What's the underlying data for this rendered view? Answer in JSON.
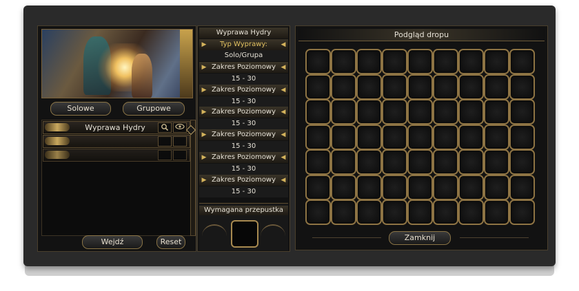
{
  "left": {
    "solo_label": "Solowe",
    "group_label": "Grupowe",
    "expeditions": [
      "Wyprawa Hydry",
      "",
      ""
    ],
    "enter_label": "Wejdź",
    "reset_label": "Reset"
  },
  "middle": {
    "title": "Wyprawa Hydry",
    "type_label": "Typ Wyprawy:",
    "type_value": "Solo/Grupa",
    "ranges": [
      {
        "label": "Zakres Poziomowy",
        "value": "15 - 30"
      },
      {
        "label": "Zakres Poziomowy",
        "value": "15 - 30"
      },
      {
        "label": "Zakres Poziomowy",
        "value": "15 - 30"
      },
      {
        "label": "Zakres Poziomowy",
        "value": "15 - 30"
      },
      {
        "label": "Zakres Poziomowy",
        "value": "15 - 30"
      },
      {
        "label": "Zakres Poziomowy",
        "value": "15 - 30"
      }
    ],
    "pass_label": "Wymagana przepustka"
  },
  "right": {
    "title": "Podgląd dropu",
    "close_label": "Zamknij",
    "grid": {
      "rows": 7,
      "cols": 9
    }
  },
  "icons": {
    "search": "magnifier-icon",
    "view": "eye-icon",
    "arrow_left": "◀",
    "arrow_right": "▶"
  },
  "colors": {
    "accent_gold": "#d4b35c",
    "frame_gold": "#8e7444",
    "text_light": "#e6e1d6"
  }
}
